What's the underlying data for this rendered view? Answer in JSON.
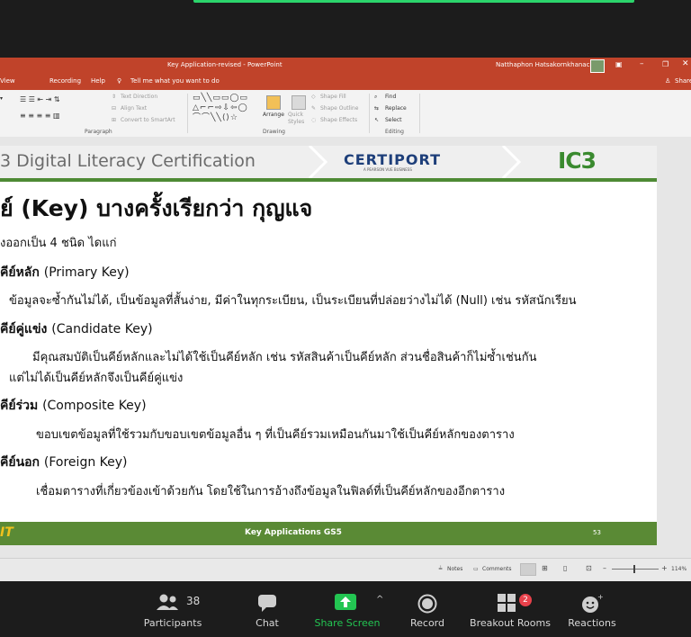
{
  "powerpoint": {
    "window_title": "Key Application-revised  -  PowerPoint",
    "user_name": "Natthaphon Hatsakornkhanachok",
    "share_label": "Share",
    "menu_items": [
      "View",
      "Recording",
      "Help"
    ],
    "tell_me": "Tell me what you want to do",
    "ribbon": {
      "text_direction": "Text Direction",
      "align_text": "Align Text",
      "convert_smartart": "Convert to SmartArt",
      "paragraph_label": "Paragraph",
      "arrange": "Arrange",
      "quick_styles": "Quick Styles",
      "shape_fill": "Shape Fill",
      "shape_outline": "Shape Outline",
      "shape_effects": "Shape Effects",
      "drawing_label": "Drawing",
      "find": "Find",
      "replace": "Replace",
      "select": "Select",
      "editing_label": "Editing"
    },
    "status": {
      "notes": "Notes",
      "comments": "Comments",
      "zoom": "114%"
    }
  },
  "slide": {
    "header_text": "3 Digital Literacy Certification",
    "certiport_logo": "CERTIPORT",
    "certiport_tagline": "A PEARSON VUE BUSINESS",
    "ic3_logo": "IC3",
    "heading": "ย์ (Key) บางครั้งเรียกว่า กุญแจ",
    "intro": "งออกเป็น 4 ชนิด ไดแก่",
    "items": [
      {
        "title_th": "คีย์หลัก",
        "title_en": "(Primary Key)",
        "body": [
          "ข้อมูลจะซ้ำกันไม่ได้, เป็นข้อมูลที่สั้นง่าย, มีค่าในทุกระเบียน, เป็นระเบียนที่ปล่อยว่างไม่ได้ (Null) เช่น รหัสนักเรียน"
        ]
      },
      {
        "title_th": "คีย์คู่แข่ง",
        "title_en": "(Candidate Key)",
        "body": [
          "มีคุณสมบัติเป็นคีย์หลักและไม่ได้ใช้เป็นคีย์หลัก เช่น รหัสสินค้าเป็นคีย์หลัก ส่วนชื่อสินค้าก็ไม่ซ้ำเช่นกัน",
          "แต่ไม่ได้เป็นคีย์หลักจึงเป็นคีย์คู่แข่ง"
        ]
      },
      {
        "title_th": "คีย์ร่วม",
        "title_en": "(Composite Key)",
        "body": [
          "ขอบเขตข้อมูลที่ใช้รวมกับขอบเขตข้อมูลอื่น ๆ ที่เป็นคีย์รวมเหมือนกันมาใช้เป็นคีย์หลักของตาราง"
        ]
      },
      {
        "title_th": "คีย์นอก",
        "title_en": "(Foreign Key)",
        "body": [
          "เชื่อมตารางที่เกี่ยวข้องเข้าด้วยกัน โดยใช้ในการอ้างถึงข้อมูลในฟิลด์ที่เป็นคีย์หลักของอีกตาราง"
        ]
      }
    ],
    "footer_left": "IT",
    "footer_title": "Key Applications GS5",
    "page_number": "53"
  },
  "zoom_toolbar": {
    "participants_label": "Participants",
    "participants_count": "38",
    "chat_label": "Chat",
    "share_label": "Share Screen",
    "record_label": "Record",
    "breakout_label": "Breakout Rooms",
    "breakout_badge": "2",
    "reactions_label": "Reactions"
  },
  "colors": {
    "ppt_accent": "#c0432a",
    "slide_green": "#5a8a35",
    "share_green": "#23c552",
    "badge_red": "#e8414b"
  }
}
